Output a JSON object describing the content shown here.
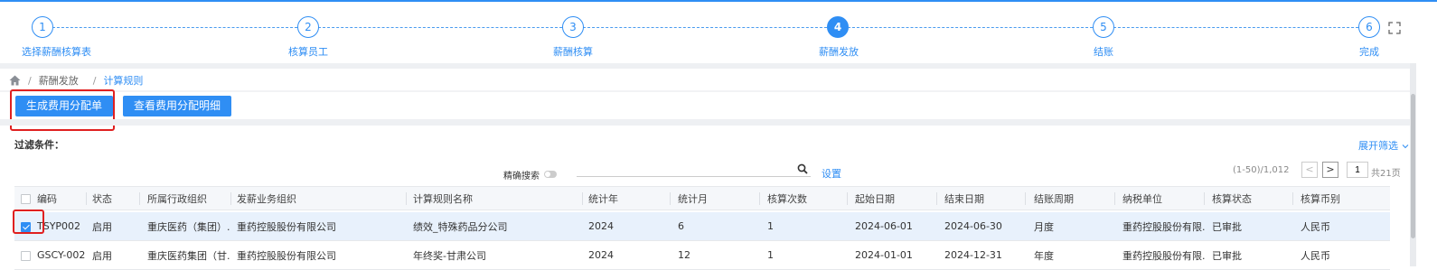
{
  "stepper": {
    "steps": [
      {
        "number": "1",
        "label": "选择薪酬核算表"
      },
      {
        "number": "2",
        "label": "核算员工"
      },
      {
        "number": "3",
        "label": "薪酬核算"
      },
      {
        "number": "4",
        "label": "薪酬发放"
      },
      {
        "number": "5",
        "label": "结账"
      },
      {
        "number": "6",
        "label": "完成"
      }
    ],
    "active_step": 4
  },
  "breadcrumb": {
    "separator": "/",
    "items": [
      "薪酬发放",
      "计算规则"
    ]
  },
  "toolbar": {
    "generate_label": "生成费用分配单",
    "view_label": "查看费用分配明细"
  },
  "filter": {
    "title": "过滤条件：",
    "expand_label": "展开筛选",
    "precise_label": "精确搜索",
    "search_placeholder": "",
    "settings_label": "设置"
  },
  "pager": {
    "range": "(1-50)/1,012",
    "prev": "<",
    "next": ">",
    "current_page": "1",
    "total_pages": "共21页"
  },
  "table": {
    "columns": [
      "编码",
      "状态",
      "所属行政组织",
      "发薪业务组织",
      "计算规则名称",
      "统计年",
      "统计月",
      "核算次数",
      "起始日期",
      "结束日期",
      "结账周期",
      "纳税单位",
      "核算状态",
      "核算币别"
    ],
    "rows": [
      {
        "checked": true,
        "cells": [
          "TSYP002",
          "启用",
          "重庆医药（集团）...",
          "重药控股股份有限公司",
          "绩效_特殊药品分公司",
          "2024",
          "6",
          "1",
          "2024-06-01",
          "2024-06-30",
          "月度",
          "重药控股股份有限...",
          "已审批",
          "人民币"
        ]
      },
      {
        "checked": false,
        "cells": [
          "GSCY-002",
          "启用",
          "重庆医药集团（甘...",
          "重药控股股份有限公司",
          "年终奖-甘肃公司",
          "2024",
          "12",
          "1",
          "2024-01-01",
          "2024-12-31",
          "年度",
          "重药控股股份有限...",
          "已审批",
          "人民币"
        ]
      }
    ]
  },
  "colors": {
    "accent": "#2f8ef4",
    "highlight": "#e02020"
  }
}
